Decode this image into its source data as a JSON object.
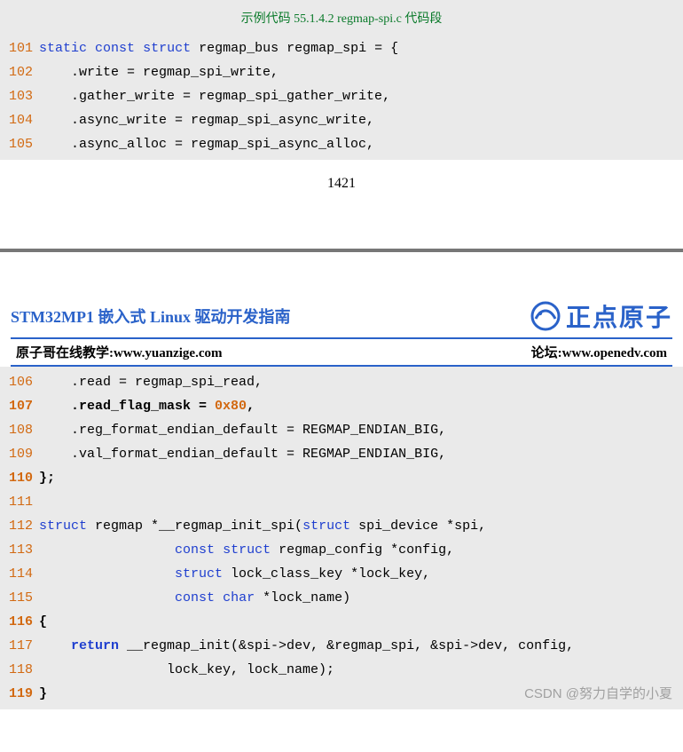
{
  "code_title": "示例代码 55.1.4.2 regmap-spi.c 代码段",
  "page_number": "1421",
  "doc_title": "STM32MP1 嵌入式 Linux 驱动开发指南",
  "brand_name": "正点原子",
  "subbar_left_label": "原子哥在线教学:",
  "subbar_left_url": "www.yuanzige.com",
  "subbar_right_label": "论坛:",
  "subbar_right_url": "www.openedv.com",
  "watermark": "CSDN @努力自学的小夏",
  "block1": {
    "l101": {
      "n": "101",
      "a": "static",
      "b": "const",
      "c": "struct",
      "rest": " regmap_bus regmap_spi = {"
    },
    "l102": {
      "n": "102",
      "t": "    .write = regmap_spi_write,"
    },
    "l103": {
      "n": "103",
      "t": "    .gather_write = regmap_spi_gather_write,"
    },
    "l104": {
      "n": "104",
      "t": "    .async_write = regmap_spi_async_write,"
    },
    "l105": {
      "n": "105",
      "t": "    .async_alloc = regmap_spi_async_alloc,"
    }
  },
  "block2": {
    "l106": {
      "n": "106",
      "t": "    .read = regmap_spi_read,"
    },
    "l107": {
      "n": "107",
      "pre": "    .read_flag_mask = ",
      "val": "0x80",
      "post": ","
    },
    "l108": {
      "n": "108",
      "t": "    .reg_format_endian_default = REGMAP_ENDIAN_BIG,"
    },
    "l109": {
      "n": "109",
      "t": "    .val_format_endian_default = REGMAP_ENDIAN_BIG,"
    },
    "l110": {
      "n": "110",
      "t": "};"
    },
    "l111": {
      "n": "111",
      "t": ""
    },
    "l112": {
      "n": "112",
      "a": "struct",
      "mid": " regmap *__regmap_init_spi(",
      "b": "struct",
      "rest": " spi_device *spi,"
    },
    "l113": {
      "n": "113",
      "pad": "                 ",
      "a": "const",
      "sp": " ",
      "b": "struct",
      "rest": " regmap_config *config,"
    },
    "l114": {
      "n": "114",
      "pad": "                 ",
      "a": "struct",
      "rest": " lock_class_key *lock_key,"
    },
    "l115": {
      "n": "115",
      "pad": "                 ",
      "a": "const",
      "sp": " ",
      "b": "char",
      "rest": " *lock_name)"
    },
    "l116": {
      "n": "116",
      "t": "{"
    },
    "l117": {
      "n": "117",
      "pad": "    ",
      "a": "return",
      "rest": " __regmap_init(&spi->dev, &regmap_spi, &spi->dev, config,"
    },
    "l118": {
      "n": "118",
      "t": "                lock_key, lock_name);"
    },
    "l119": {
      "n": "119",
      "t": "}"
    }
  }
}
